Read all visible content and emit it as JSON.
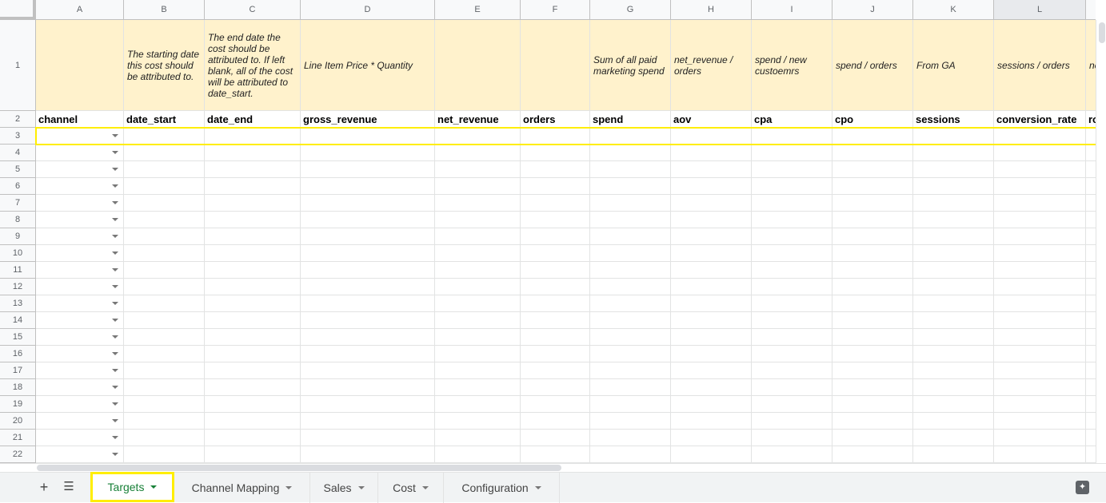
{
  "columns": [
    "A",
    "B",
    "C",
    "D",
    "E",
    "F",
    "G",
    "H",
    "I",
    "J",
    "K",
    "L",
    ""
  ],
  "selected_column": "L",
  "notes": [
    "",
    "The starting date this cost should be attributed to.",
    "The end date the cost should be attributed to. If left blank, all of the cost will be attributed to date_start.",
    "Line Item Price * Quantity",
    "",
    "",
    "Sum of all paid marketing spend",
    "net_revenue / orders",
    "spend / new custoemrs",
    "spend / orders",
    "From GA",
    "sessions / orders",
    "ne sp"
  ],
  "headers": [
    "channel",
    "date_start",
    "date_end",
    "gross_revenue",
    "net_revenue",
    "orders",
    "spend",
    "aov",
    "cpa",
    "cpo",
    "sessions",
    "conversion_rate",
    "ro"
  ],
  "row_numbers": [
    "1",
    "2",
    "3",
    "4",
    "5",
    "6",
    "7",
    "8",
    "9",
    "10",
    "11",
    "12",
    "13",
    "14",
    "15",
    "16",
    "17",
    "18",
    "19",
    "20",
    "21",
    "22"
  ],
  "colors": {
    "note_bg": "#fff2cc",
    "highlight": "#ffee00",
    "active_tab": "#188038"
  },
  "tabs": [
    {
      "label": "Targets",
      "active": true
    },
    {
      "label": "Channel Mapping"
    },
    {
      "label": "Sales"
    },
    {
      "label": "Cost"
    },
    {
      "label": "Configuration"
    }
  ],
  "icons": {
    "add_sheet": "plus-icon",
    "all_sheets": "list-icon",
    "explore": "explore-icon"
  }
}
